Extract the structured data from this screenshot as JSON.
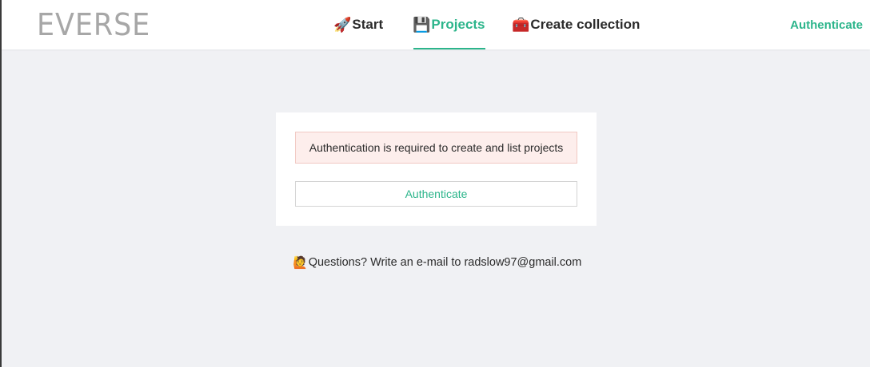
{
  "header": {
    "logo": "EVERSE",
    "nav": [
      {
        "icon": "rocket-icon",
        "emoji": "🚀",
        "label": "Start"
      },
      {
        "icon": "floppy-disk-icon",
        "emoji": "💾",
        "label": "Projects",
        "active": true
      },
      {
        "icon": "toolbox-icon",
        "emoji": "🧰",
        "label": "Create collection"
      }
    ],
    "auth_label": "Authenticate"
  },
  "card": {
    "alert_text": "Authentication is required to create and list projects",
    "button_label": "Authenticate"
  },
  "footer": {
    "icon": "person-raising-hand-icon",
    "emoji": "🙋",
    "text": "Questions? Write an e-mail to radslow97@gmail.com"
  },
  "colors": {
    "accent": "#2cb58b",
    "alert_bg": "#fdeeec",
    "page_bg": "#f0f1f4"
  }
}
